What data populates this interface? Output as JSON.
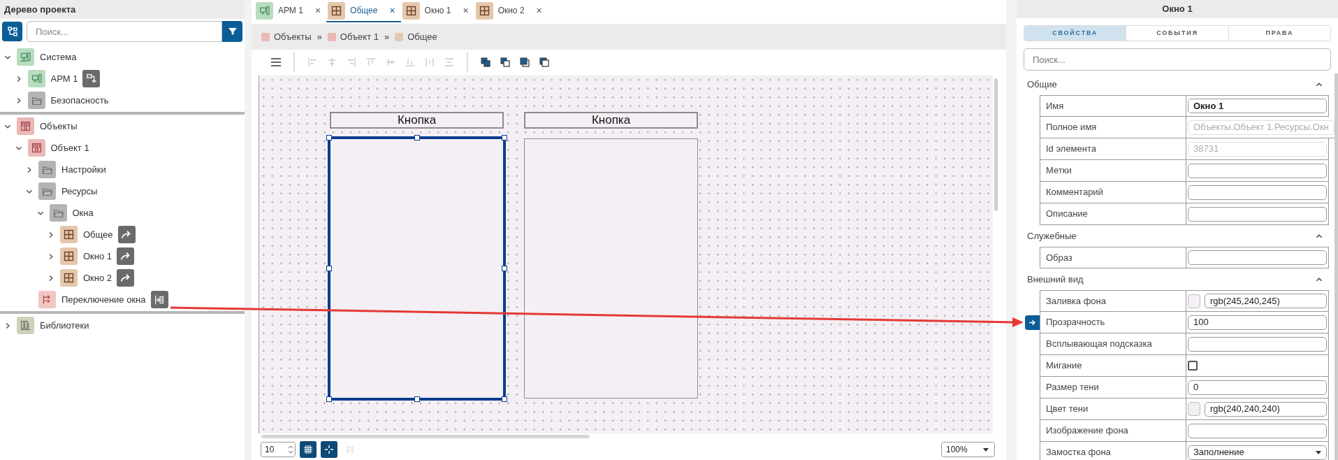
{
  "tree_panel": {
    "title": "Дерево проекта",
    "search": {
      "placeholder": "Поиск..."
    }
  },
  "tree_sections": [
    {
      "items": [
        {
          "label": "Система",
          "kind": "system",
          "expanded": true,
          "children": [
            {
              "label": "АРМ 1",
              "kind": "workstation",
              "expanded": false,
              "badge": {
                "kind": "export"
              }
            },
            {
              "label": "Безопасность",
              "kind": "folder",
              "expanded": false
            }
          ]
        }
      ]
    },
    {
      "items": [
        {
          "label": "Объекты",
          "kind": "objects",
          "expanded": true,
          "children": [
            {
              "label": "Объект 1",
              "kind": "object",
              "expanded": true,
              "children": [
                {
                  "label": "Настройки",
                  "kind": "folder",
                  "expanded": false
                },
                {
                  "label": "Ресурсы",
                  "kind": "folder",
                  "expanded": true,
                  "children": [
                    {
                      "label": "Окна",
                      "kind": "folder",
                      "expanded": true,
                      "children": [
                        {
                          "label": "Общее",
                          "kind": "window",
                          "expanded": false,
                          "badge": {
                            "kind": "link"
                          }
                        },
                        {
                          "label": "Окно 1",
                          "kind": "window",
                          "expanded": false,
                          "badge": {
                            "kind": "link"
                          }
                        },
                        {
                          "label": "Окно 2",
                          "kind": "window",
                          "expanded": false,
                          "badge": {
                            "kind": "link"
                          }
                        }
                      ]
                    }
                  ]
                },
                {
                  "label": "Переключение окна",
                  "kind": "switch",
                  "badge": {
                    "kind": "script"
                  }
                }
              ]
            }
          ]
        }
      ]
    },
    {
      "items": [
        {
          "label": "Библиотеки",
          "kind": "library",
          "expanded": false
        }
      ]
    }
  ],
  "tabs": [
    {
      "label": "АРМ 1",
      "kind": "workstation",
      "close": "×",
      "selected": false
    },
    {
      "label": "Общее",
      "kind": "window",
      "close": "×",
      "selected": true
    },
    {
      "label": "Окно 1",
      "kind": "window",
      "close": "×",
      "selected": false
    },
    {
      "label": "Окно 2",
      "kind": "window",
      "close": "×",
      "selected": false
    }
  ],
  "breadcrumbs": [
    {
      "label": "Объекты",
      "color": "#e9b9b6",
      "separator": "»"
    },
    {
      "label": "Объект 1",
      "color": "#e9b9b6",
      "separator": "»"
    },
    {
      "label": "Общее",
      "color": "#e4c8ad"
    }
  ],
  "toolbar": [
    {
      "kind": "menu",
      "disabled": false
    },
    {
      "kind": "divider"
    },
    {
      "kind": "align-left",
      "disabled": true
    },
    {
      "kind": "align-center",
      "disabled": true
    },
    {
      "kind": "align-right",
      "disabled": true
    },
    {
      "kind": "align-top",
      "disabled": true
    },
    {
      "kind": "align-middle",
      "disabled": true
    },
    {
      "kind": "align-bottom",
      "disabled": true
    },
    {
      "kind": "distribute-h",
      "disabled": true
    },
    {
      "kind": "distribute-v",
      "disabled": true
    },
    {
      "kind": "divider"
    },
    {
      "kind": "bring-front",
      "disabled": false
    },
    {
      "kind": "send-back",
      "disabled": false
    },
    {
      "kind": "forward",
      "disabled": false
    },
    {
      "kind": "backward",
      "disabled": false
    }
  ],
  "canvas": {
    "columns": [
      {
        "button": "Кнопка",
        "window_selected": true
      },
      {
        "button": "Кнопка",
        "window_selected": false
      }
    ]
  },
  "bottom_bar": {
    "grid_size": "10",
    "grid_on": true,
    "snap_on": true,
    "guides_on": false,
    "zoom": "100%"
  },
  "properties_panel": {
    "title": "Окно 1",
    "tabs": [
      {
        "label": "СВОЙСТВА",
        "selected": true
      },
      {
        "label": "СОБЫТИЯ",
        "selected": false
      },
      {
        "label": "ПРАВА",
        "selected": false
      }
    ],
    "search": {
      "placeholder": "Поиск..."
    },
    "sections": [
      {
        "title": "Общие",
        "expanded": true,
        "rows": [
          {
            "label": "Имя",
            "kind": "text",
            "value": "Окно 1",
            "bold": true,
            "disabled": false
          },
          {
            "label": "Полное имя",
            "kind": "text",
            "value": "Объекты.Объект 1.Ресурсы.Окн",
            "disabled": true
          },
          {
            "label": "Id элемента",
            "kind": "text",
            "value": "38731",
            "disabled": true
          },
          {
            "label": "Метки",
            "kind": "text",
            "disabled": false
          },
          {
            "label": "Комментарий",
            "kind": "text",
            "disabled": false
          },
          {
            "label": "Описание",
            "kind": "text",
            "disabled": false
          }
        ]
      },
      {
        "title": "Служебные",
        "expanded": true,
        "rows": [
          {
            "label": "Образ",
            "kind": "text",
            "disabled": false
          }
        ]
      },
      {
        "title": "Внешний вид",
        "expanded": true,
        "rows": [
          {
            "label": "Заливка фона",
            "kind": "color",
            "color": "#f5f0f5",
            "value": "rgb(245,240,245)"
          },
          {
            "label": "Прозрачность",
            "kind": "text",
            "value": "100",
            "disabled": false,
            "linked": true
          },
          {
            "label": "Всплывающая подсказка",
            "kind": "text",
            "disabled": false
          },
          {
            "label": "Мигание",
            "kind": "checkbox",
            "checked": false
          },
          {
            "label": "Размер тени",
            "kind": "text",
            "value": "0",
            "disabled": false
          },
          {
            "label": "Цвет тени",
            "kind": "color",
            "color": "#f0f0f0",
            "value": "rgb(240,240,240)"
          },
          {
            "label": "Изображение фона",
            "kind": "text",
            "disabled": false
          },
          {
            "label": "Замостка фона",
            "kind": "select",
            "value": "Заполнение"
          }
        ]
      }
    ]
  }
}
